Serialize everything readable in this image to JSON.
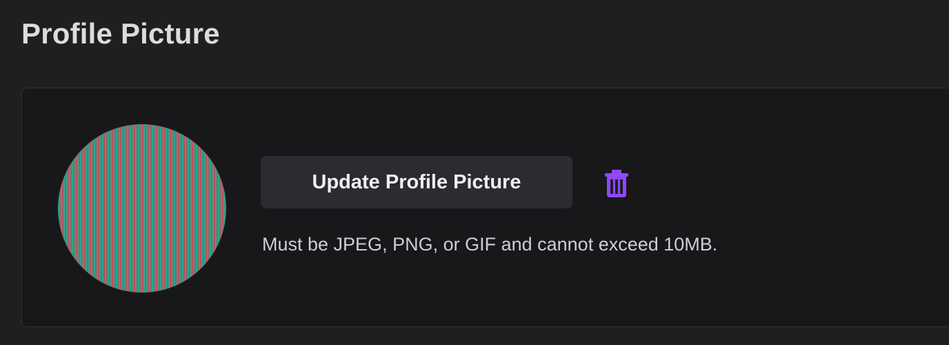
{
  "section": {
    "title": "Profile Picture"
  },
  "profile_picture": {
    "update_button_label": "Update Profile Picture",
    "delete_icon": "trash-icon",
    "hint": "Must be JPEG, PNG, or GIF and cannot exceed 10MB."
  },
  "colors": {
    "background": "#1f1f22",
    "card_background": "#18181b",
    "card_border": "#303033",
    "button_background": "#2c2c30",
    "accent": "#9147ff",
    "avatar_stripe_a": "#2aa68c",
    "avatar_stripe_b": "#b2565f"
  }
}
